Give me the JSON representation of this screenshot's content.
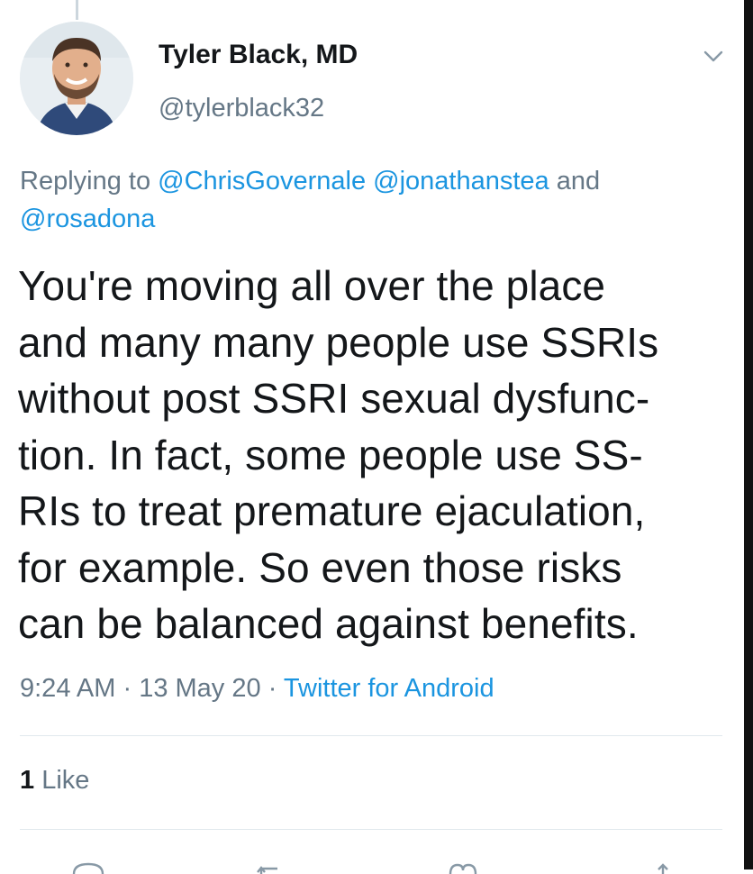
{
  "tweet": {
    "author_name": "Tyler Black, MD",
    "handle": "@tylerblack32",
    "replying_prefix": "Replying to",
    "reply_mentions": [
      "@ChrisGovernale",
      "@jonathanstea",
      "@rosadona"
    ],
    "reply_conjunction": "and",
    "text_lines": [
      "You're moving all over the place",
      "and many many people use SSRIs",
      "without post SSRI sexual dysfunc-",
      "tion.  In fact, some people use SS-",
      "RIs to treat premature ejaculation,",
      "for example.  So even those risks",
      "can be balanced against benefits."
    ],
    "time": "9:24 AM",
    "separator": "·",
    "date": "13 May 20",
    "source": "Twitter for Android",
    "like_count": "1",
    "like_label": "Like"
  },
  "icons": {
    "chevron": "chevron-down-icon",
    "actions": [
      "reply-icon",
      "retweet-icon",
      "like-icon",
      "share-icon"
    ]
  },
  "colors": {
    "text": "#14171a",
    "secondary": "#657786",
    "link": "#1b95e0",
    "divider": "#e1e8ed"
  }
}
